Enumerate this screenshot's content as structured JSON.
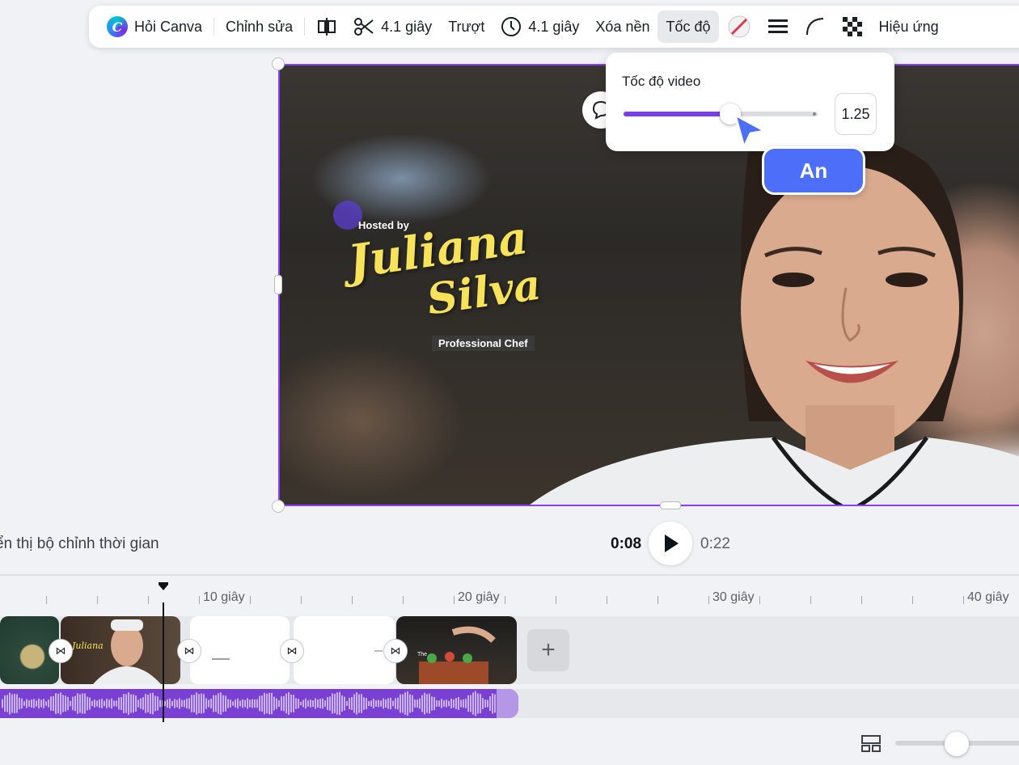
{
  "toolbar": {
    "ask_canva": "Hỏi Canva",
    "edit": "Chỉnh sửa",
    "split_duration": "4.1 giây",
    "slide": "Trượt",
    "timer_duration": "4.1 giây",
    "remove_bg": "Xóa nền",
    "speed": "Tốc độ",
    "effects": "Hiệu ứng",
    "icons": [
      "canva-logo-icon",
      "flip-icon",
      "scissors-icon",
      "clock-icon",
      "no-color-icon",
      "lines-icon",
      "corner-icon",
      "transparency-icon"
    ]
  },
  "canvas": {
    "hosted_by": "Hosted by",
    "name_line1": "Juliana",
    "name_line2": "Silva",
    "subtitle": "Professional Chef"
  },
  "speed_popover": {
    "title": "Tốc độ video",
    "value": "1.25",
    "slider_fraction": 0.55
  },
  "collaborator": {
    "name": "An",
    "color": "#4d6ef8"
  },
  "playback": {
    "timing_label": "ển thị bộ chỉnh thời gian",
    "current_time": "0:08",
    "total_time": "0:22"
  },
  "ruler": {
    "labels": [
      "10 giây",
      "20 giây",
      "30 giây",
      "40 giây"
    ]
  },
  "timeline": {
    "clip_text_1": "Juliana",
    "clip_text_5": "The"
  },
  "accent_color": "#8b3dff"
}
